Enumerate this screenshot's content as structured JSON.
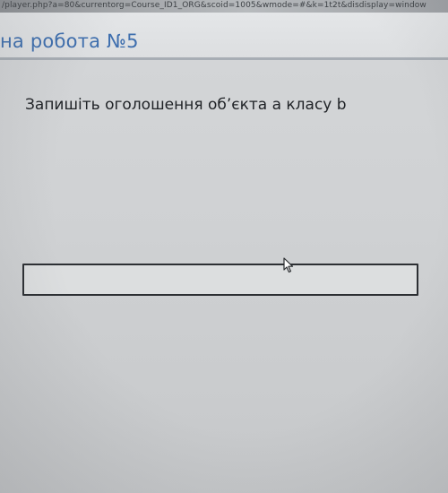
{
  "browser": {
    "address_text": "/player.php?a=80&currentorg=Course_ID1_ORG&scoid=1005&wmode=#&k=1t2t&disdisplay=window"
  },
  "header": {
    "title": "на робота №5"
  },
  "question": {
    "text": "Запишіть оголошення об’єкта а класу b"
  },
  "answer": {
    "value": "",
    "placeholder": ""
  },
  "colors": {
    "title": "#3f6fae",
    "question_text": "#1f2226",
    "box_border": "#2c2f33"
  },
  "icons": {
    "cursor": "mouse-pointer-icon"
  }
}
